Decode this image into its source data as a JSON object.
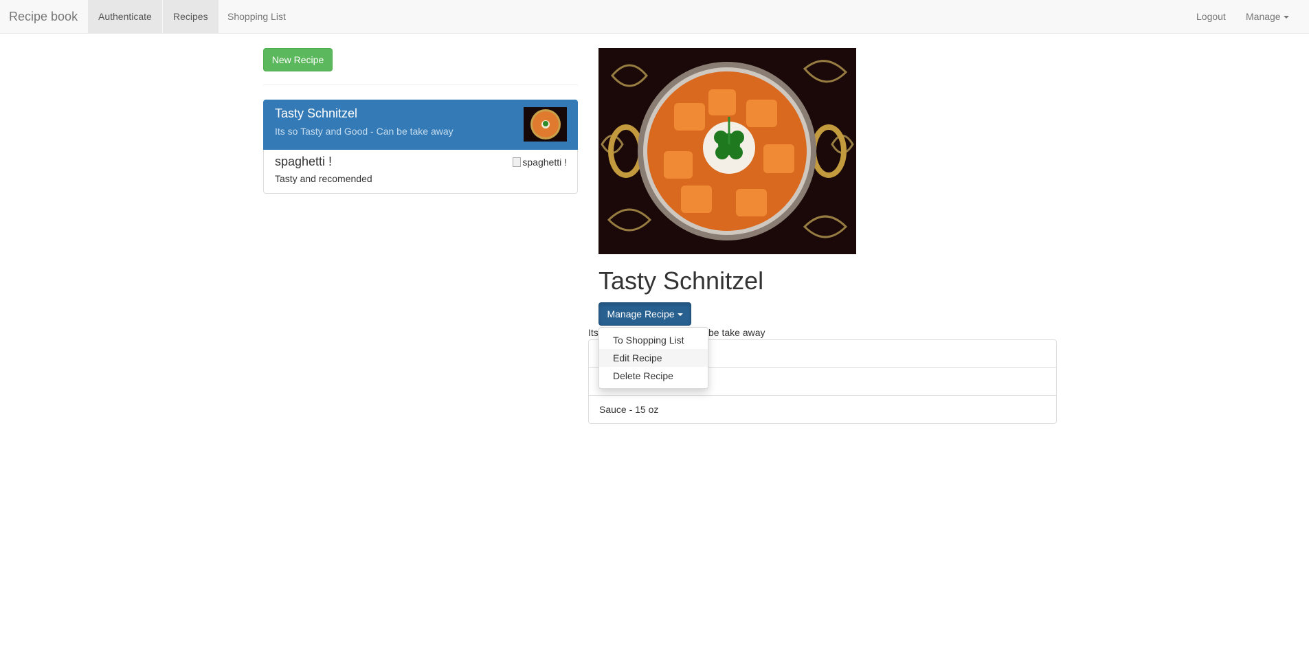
{
  "navbar": {
    "brand": "Recipe book",
    "items": [
      {
        "label": "Authenticate"
      },
      {
        "label": "Recipes"
      },
      {
        "label": "Shopping List"
      }
    ],
    "right": {
      "logout": "Logout",
      "manage": "Manage"
    }
  },
  "sidebar": {
    "new_recipe_label": "New Recipe",
    "recipes": [
      {
        "title": "Tasty Schnitzel",
        "description": "Its so Tasty and Good - Can be take away"
      },
      {
        "title": "spaghetti !",
        "description": "Tasty and recomended",
        "image_alt": "spaghetti !"
      }
    ]
  },
  "detail": {
    "title": "Tasty Schnitzel",
    "manage_label": "Manage Recipe",
    "description_visible": [
      "Its",
      "be take away"
    ],
    "ingredients": [
      "",
      "",
      "Sauce - 15 oz"
    ],
    "dropdown": [
      "To Shopping List",
      "Edit Recipe",
      "Delete Recipe"
    ]
  },
  "colors": {
    "primary": "#337ab7",
    "success": "#5cb85c",
    "active_button": "#286090"
  }
}
